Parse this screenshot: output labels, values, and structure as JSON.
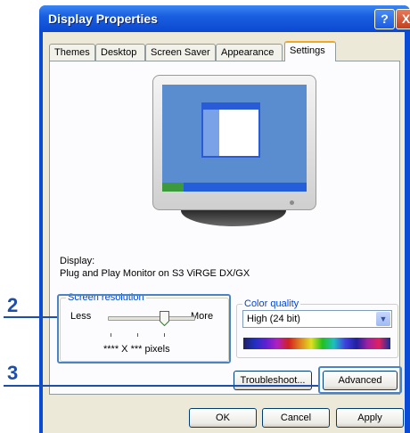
{
  "window": {
    "title": "Display Properties",
    "help_glyph": "?",
    "close_glyph": "X"
  },
  "tabs": [
    {
      "label": "Themes"
    },
    {
      "label": "Desktop"
    },
    {
      "label": "Screen Saver"
    },
    {
      "label": "Appearance"
    },
    {
      "label": "Settings",
      "active": true
    }
  ],
  "display": {
    "label": "Display:",
    "value": "Plug and Play Monitor on S3 ViRGE DX/GX"
  },
  "screen_resolution": {
    "legend": "Screen resolution",
    "less_label": "Less",
    "more_label": "More",
    "value_text": "**** X *** pixels"
  },
  "color_quality": {
    "legend": "Color quality",
    "selected": "High (24 bit)",
    "dropdown_glyph": "▼"
  },
  "buttons": {
    "troubleshoot": "Troubleshoot...",
    "advanced": "Advanced",
    "ok": "OK",
    "cancel": "Cancel",
    "apply": "Apply"
  },
  "callouts": {
    "first": "2",
    "second": "3"
  },
  "colors": {
    "title_blue": "#0b48d0",
    "callout_blue": "#1e4fa8",
    "tab_highlight": "#f5a623"
  }
}
